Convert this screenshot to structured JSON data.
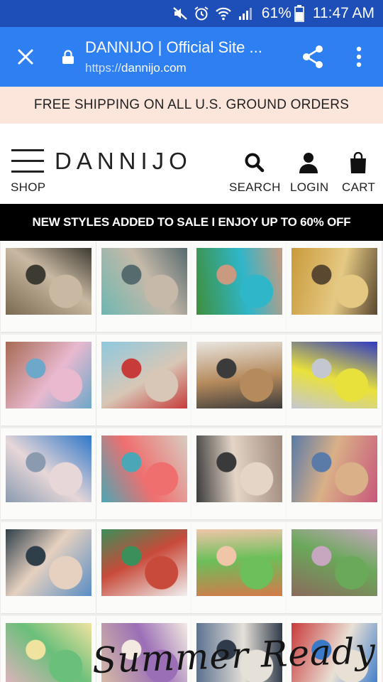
{
  "status_bar": {
    "battery": "61%",
    "time": "11:47 AM",
    "icons": [
      "mute-icon",
      "alarm-icon",
      "wifi-icon",
      "signal-icon",
      "battery-icon"
    ]
  },
  "browser": {
    "title": "DANNIJO | Official Site ...",
    "url_scheme": "https://",
    "url_host": "dannijo.com"
  },
  "promo": {
    "text": "FREE SHIPPING ON ALL U.S. GROUND ORDERS"
  },
  "header": {
    "logo": "DANNIJO",
    "shop_label": "SHOP",
    "search_label": "SEARCH",
    "login_label": "LOGIN",
    "cart_label": "CART"
  },
  "sale_banner": {
    "text": "NEW STYLES ADDED TO SALE I ENJOY UP TO 60% OFF"
  },
  "collage": {
    "overlay_text": "Summer Ready",
    "photos": [
      {
        "name": "photo-beach-bikini-tree",
        "colors": [
          "#7a6a52",
          "#c9b9a2",
          "#3d3a32"
        ]
      },
      {
        "name": "photo-jewelry-pile-teal",
        "colors": [
          "#6fb7b0",
          "#c6b9a9",
          "#566b6e"
        ]
      },
      {
        "name": "photo-woman-on-grass",
        "colors": [
          "#3f8f3b",
          "#2fb6c9",
          "#c99a80"
        ]
      },
      {
        "name": "photo-stacked-bracelets-gold",
        "colors": [
          "#c99a3b",
          "#e5c983",
          "#5a4830"
        ]
      },
      {
        "name": "photo-two-women-brick",
        "colors": [
          "#a76a53",
          "#e8b9cf",
          "#6da7c9"
        ]
      },
      {
        "name": "photo-bracelets-blue-heels",
        "colors": [
          "#8ec9df",
          "#d8c7b6",
          "#c73b3b"
        ]
      },
      {
        "name": "photo-hands-stacked-bracelets",
        "colors": [
          "#e9e6e1",
          "#b58a5c",
          "#3b3b3b"
        ]
      },
      {
        "name": "photo-women-blue-background",
        "colors": [
          "#2f3bc2",
          "#e9e13b",
          "#c5c7d0"
        ]
      },
      {
        "name": "photo-woman-jumping-beach",
        "colors": [
          "#2f77c9",
          "#e7d7d8",
          "#8a9bb0"
        ]
      },
      {
        "name": "photo-friends-smiling-swimsuits",
        "colors": [
          "#d8ccc0",
          "#ef6f6f",
          "#4ba7b5"
        ]
      },
      {
        "name": "photo-woman-sunglasses-city",
        "colors": [
          "#9f8a7c",
          "#e4d5c7",
          "#3a3a3a"
        ]
      },
      {
        "name": "photo-woven-bracelets-colorful",
        "colors": [
          "#c8577b",
          "#d9b087",
          "#5a7aa7"
        ]
      },
      {
        "name": "photo-woman-heart-sunglasses",
        "colors": [
          "#5a8dc4",
          "#e6d1c0",
          "#2f3f4a"
        ]
      },
      {
        "name": "photo-shell-bracelets-row",
        "colors": [
          "#f0f0f0",
          "#c84a3a",
          "#3b8f5a"
        ]
      },
      {
        "name": "photo-woman-palm-trees",
        "colors": [
          "#d37a4a",
          "#6cbf5a",
          "#f0c6a9"
        ]
      },
      {
        "name": "photo-woman-balloons-street",
        "colors": [
          "#8b6a5c",
          "#6aa85a",
          "#c7a7c0"
        ]
      },
      {
        "name": "photo-tie-dye-dress",
        "colors": [
          "#e7b2c1",
          "#6abf7a",
          "#f0e3a0"
        ]
      },
      {
        "name": "photo-beach-tie-dye-group",
        "colors": [
          "#d9bfa4",
          "#9b6fb6",
          "#f3eae2"
        ]
      },
      {
        "name": "photo-friends-walking-street",
        "colors": [
          "#5a7090",
          "#e5e0d8",
          "#2f3a4a"
        ]
      },
      {
        "name": "photo-hands-colorful-bracelets",
        "colors": [
          "#c93b3b",
          "#e9e0d5",
          "#3b7ac9"
        ]
      }
    ]
  }
}
